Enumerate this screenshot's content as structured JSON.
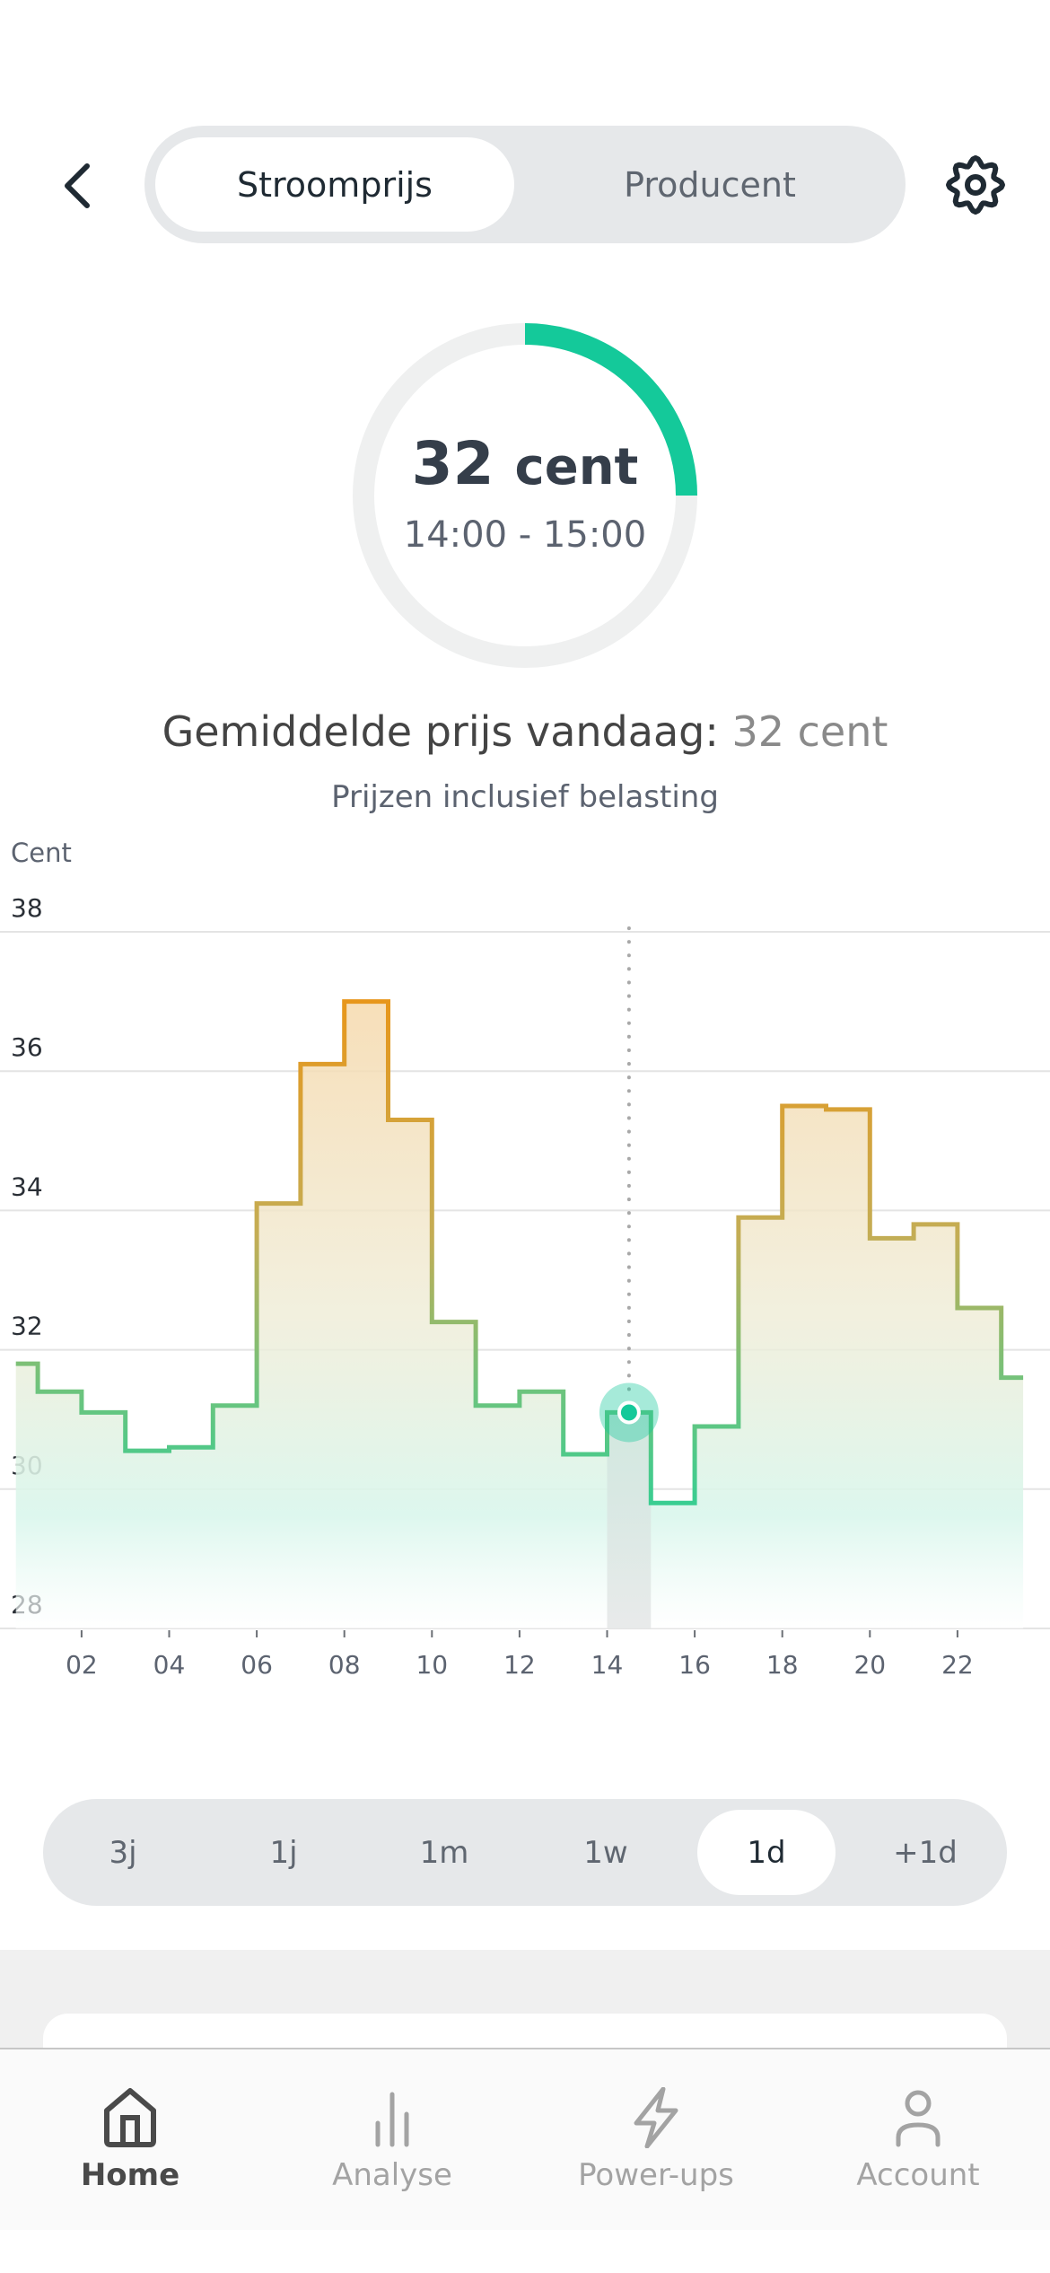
{
  "header": {
    "back_icon": "chevron-left-icon",
    "tabs": [
      {
        "label": "Stroomprijs",
        "active": true
      },
      {
        "label": "Producent",
        "active": false
      }
    ],
    "settings_icon": "gear-icon"
  },
  "current_price": {
    "value": "32",
    "unit": "cent",
    "time_range": "14:00 - 15:00",
    "gauge_fraction": 0.25,
    "gauge_color": "#14c99a",
    "gauge_track_color": "#eff0f0"
  },
  "average": {
    "label": "Gemiddelde prijs vandaag:",
    "value": "32 cent"
  },
  "subtitle": "Prijzen inclusief belasting",
  "chart_data": {
    "type": "line",
    "step": true,
    "ylabel": "Cent",
    "xlabel": "",
    "ylim": [
      28,
      38
    ],
    "xlim": [
      0.5,
      23.5
    ],
    "y_ticks": [
      "38",
      "36",
      "34",
      "32",
      "30",
      "28"
    ],
    "y_tick_values": [
      38,
      36,
      34,
      32,
      30,
      28
    ],
    "x_ticks": [
      "02",
      "04",
      "06",
      "08",
      "10",
      "12",
      "14",
      "16",
      "18",
      "20",
      "22"
    ],
    "x_tick_values": [
      2,
      4,
      6,
      8,
      10,
      12,
      14,
      16,
      18,
      20,
      22
    ],
    "grid": true,
    "series": [
      {
        "name": "Stroomprijs",
        "hours": [
          0,
          1,
          2,
          3,
          4,
          5,
          6,
          7,
          8,
          9,
          10,
          11,
          12,
          13,
          14,
          15,
          16,
          17,
          18,
          19,
          20,
          21,
          22,
          23
        ],
        "values": [
          31.8,
          31.4,
          31.1,
          30.55,
          30.6,
          31.2,
          34.1,
          36.1,
          37.0,
          35.3,
          32.4,
          31.2,
          31.4,
          30.5,
          31.1,
          29.8,
          30.9,
          33.9,
          35.5,
          35.45,
          33.6,
          33.8,
          32.6,
          31.6
        ]
      }
    ],
    "selected_hour": 14,
    "selected_value": 31.1,
    "colors": {
      "low": "#3ecf8e",
      "mid": "#8fbf6a",
      "high": "#e8961a",
      "highlight": "#14c99a"
    }
  },
  "range_selector": {
    "options": [
      {
        "label": "3j",
        "active": false
      },
      {
        "label": "1j",
        "active": false
      },
      {
        "label": "1m",
        "active": false
      },
      {
        "label": "1w",
        "active": false
      },
      {
        "label": "1d",
        "active": true
      },
      {
        "label": "+1d",
        "active": false
      }
    ]
  },
  "nav": {
    "items": [
      {
        "label": "Home",
        "icon": "home-icon",
        "active": true
      },
      {
        "label": "Analyse",
        "icon": "bar-chart-icon",
        "active": false
      },
      {
        "label": "Power-ups",
        "icon": "lightning-icon",
        "active": false
      },
      {
        "label": "Account",
        "icon": "user-icon",
        "active": false
      }
    ]
  }
}
